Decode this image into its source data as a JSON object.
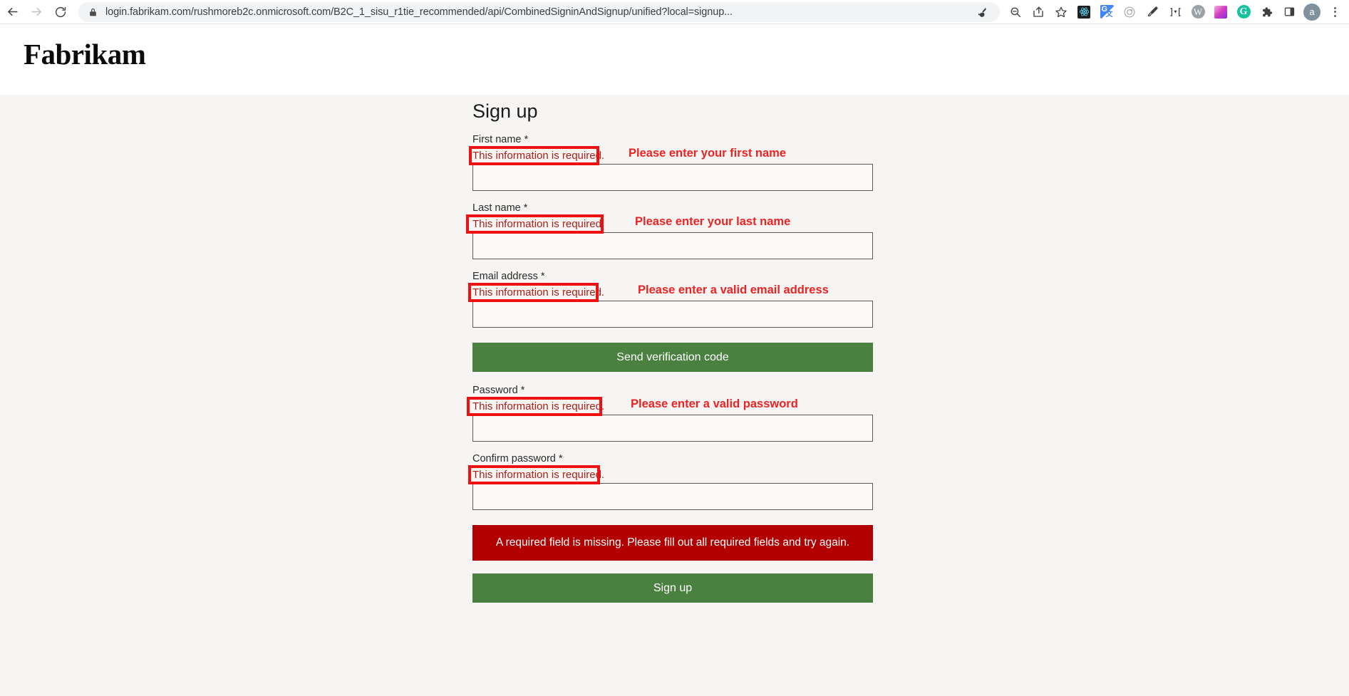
{
  "browser": {
    "nav": {
      "back_icon": "back-arrow-icon",
      "forward_icon": "forward-arrow-icon",
      "reload_icon": "reload-icon"
    },
    "omnibox": {
      "lock_icon": "lock-icon",
      "url_host": "login.fabrikam.com",
      "url_rest": "/rushmoreb2c.onmicrosoft.com/B2C_1_sisu_r1tie_recommended/api/CombinedSigninAndSignup/unified?local=signup...",
      "url_full": "login.fabrikam.com/rushmoreb2c.onmicrosoft.com/B2C_1_sisu_r1tie_recommended/api/CombinedSigninAndSignup/unified?local=signup...",
      "key_icon": "key-icon",
      "zoom_icon": "zoom-out-icon",
      "share_icon": "share-icon",
      "bookmark_icon": "star-icon"
    },
    "extensions": [
      {
        "name": "react-devtools-icon",
        "label": ""
      },
      {
        "name": "google-translate-icon",
        "label": "G"
      },
      {
        "name": "orbit-icon",
        "label": ""
      },
      {
        "name": "color-picker-icon",
        "label": ""
      },
      {
        "name": "brackets-icon",
        "label": "]▾["
      },
      {
        "name": "wallet-icon",
        "label": "W"
      },
      {
        "name": "gradient-swatch-icon",
        "label": ""
      },
      {
        "name": "grammarly-icon",
        "label": "G"
      },
      {
        "name": "puzzle-extensions-icon",
        "label": ""
      },
      {
        "name": "sidepanel-icon",
        "label": ""
      }
    ],
    "avatar_label": "a",
    "menu_icon": "kebab-menu-icon"
  },
  "brand": {
    "name": "Fabrikam"
  },
  "signup": {
    "heading": "Sign up",
    "required_error_text": "This information is required.",
    "fields": [
      {
        "label": "First name *",
        "error": "This information is required.",
        "value": "",
        "annotation": "Please enter your first name"
      },
      {
        "label": "Last name *",
        "error": "This information is required.",
        "value": "",
        "annotation": "Please enter your last name"
      },
      {
        "label": "Email address *",
        "error": "This information is required.",
        "value": "",
        "annotation": "Please enter a valid email address"
      },
      {
        "label": "Password *",
        "error": "This information is required.",
        "value": "",
        "annotation": "Please enter a valid password"
      },
      {
        "label": "Confirm password *",
        "error": "This information is required.",
        "value": "",
        "annotation": ""
      }
    ],
    "send_code_button": "Send verification code",
    "error_banner": "A required field is missing. Please fill out all required fields and try again.",
    "submit_button": "Sign up"
  },
  "colors": {
    "green_button": "#4a8040",
    "error_banner": "#b20000",
    "annotation_red": "#ee1111",
    "inline_error_red": "#a8201a",
    "page_background": "#f6f5f3"
  }
}
